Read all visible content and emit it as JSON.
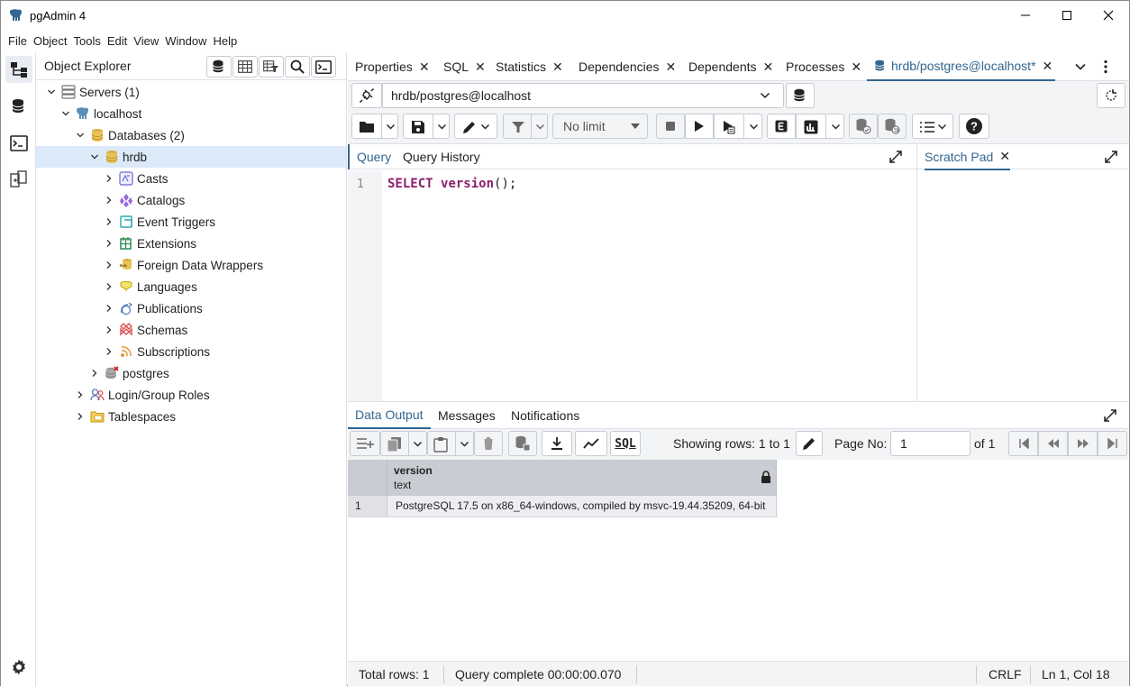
{
  "window": {
    "title": "pgAdmin 4"
  },
  "menu": [
    "File",
    "Object",
    "Tools",
    "Edit",
    "View",
    "Window",
    "Help"
  ],
  "object_explorer": {
    "title": "Object Explorer",
    "tree": [
      {
        "label": "Servers",
        "count": "(1)"
      },
      {
        "label": "localhost"
      },
      {
        "label": "Databases",
        "count": "(2)"
      },
      {
        "label": "hrdb"
      },
      {
        "label": "Casts"
      },
      {
        "label": "Catalogs"
      },
      {
        "label": "Event Triggers"
      },
      {
        "label": "Extensions"
      },
      {
        "label": "Foreign Data Wrappers"
      },
      {
        "label": "Languages"
      },
      {
        "label": "Publications"
      },
      {
        "label": "Schemas"
      },
      {
        "label": "Subscriptions"
      },
      {
        "label": "postgres"
      },
      {
        "label": "Login/Group Roles"
      },
      {
        "label": "Tablespaces"
      }
    ]
  },
  "tabs": [
    "Properties",
    "SQL",
    "Statistics",
    "Dependencies",
    "Dependents",
    "Processes",
    "hrdb/postgres@localhost*"
  ],
  "connection": {
    "value": "hrdb/postgres@localhost"
  },
  "toolbar": {
    "limit": "No limit"
  },
  "query_tabs": [
    "Query",
    "Query History"
  ],
  "scratch_pad": {
    "title": "Scratch Pad"
  },
  "editor": {
    "line_number": "1",
    "keyword": "SELECT",
    "func": "version",
    "rest": "();"
  },
  "data_output": {
    "tabs": [
      "Data Output",
      "Messages",
      "Notifications"
    ],
    "showing_rows": "Showing rows: 1 to 1",
    "page_no_label": "Page No:",
    "page_no": "1",
    "of_pages": "of 1",
    "sql_label": "SQL",
    "columns": [
      {
        "name": "version",
        "type": "text"
      }
    ],
    "rows": [
      {
        "num": "1",
        "cells": [
          "PostgreSQL 17.5 on x86_64-windows, compiled by msvc-19.44.35209, 64-bit"
        ]
      }
    ]
  },
  "status": {
    "total_rows": "Total rows: 1",
    "query_complete": "Query complete 00:00:00.070",
    "line_ending": "CRLF",
    "cursor": "Ln 1, Col 18"
  },
  "colors": {
    "accent": "#326690",
    "selected": "#dbe9f9",
    "keyword": "#8b1e6b"
  }
}
